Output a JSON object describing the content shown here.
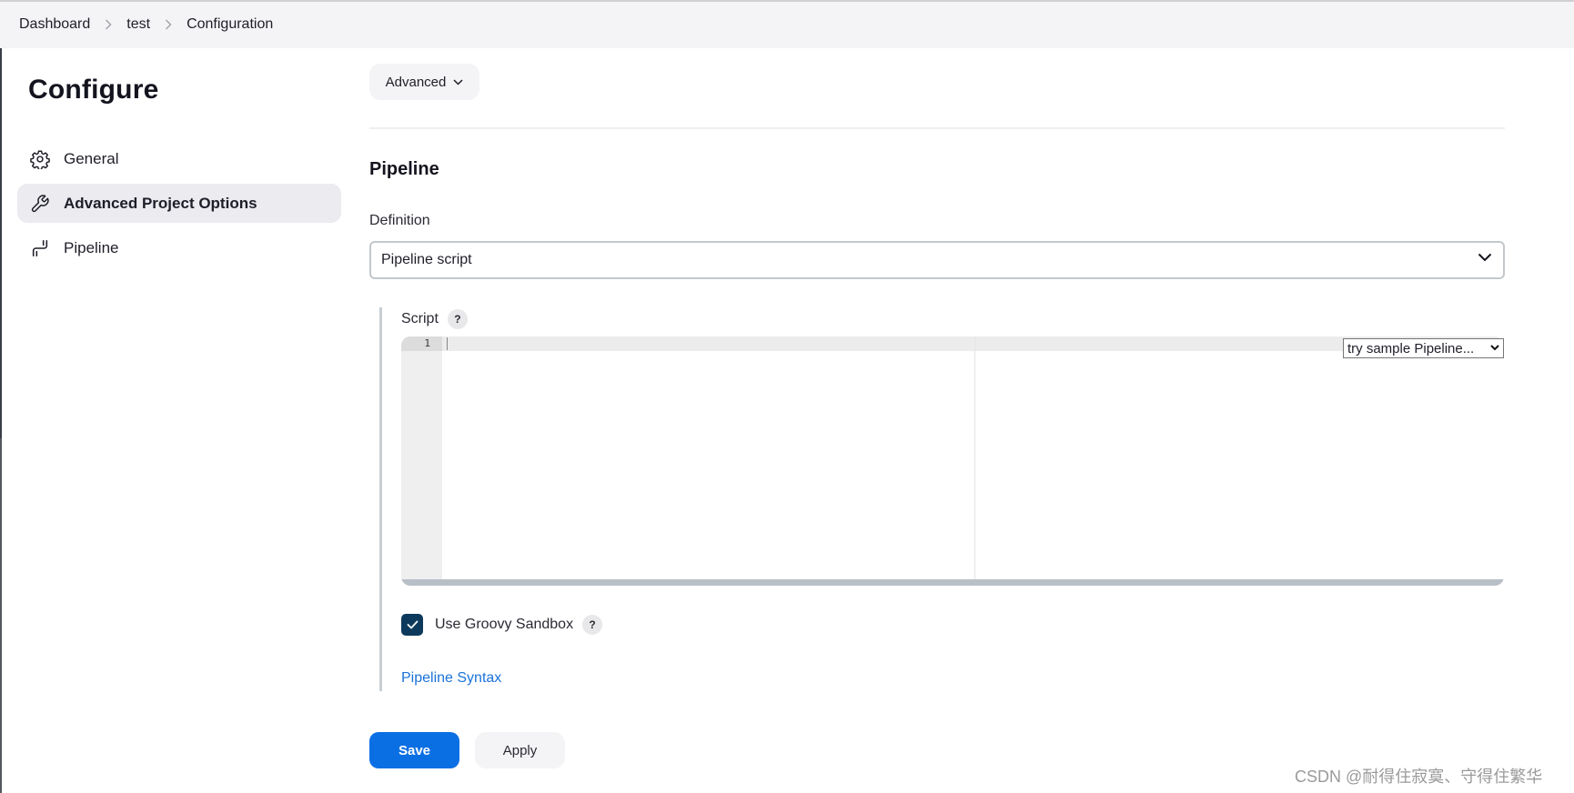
{
  "breadcrumb": {
    "items": [
      "Dashboard",
      "test",
      "Configuration"
    ]
  },
  "sidebar": {
    "title": "Configure",
    "items": [
      {
        "label": "General",
        "icon": "gear-icon",
        "active": false
      },
      {
        "label": "Advanced Project Options",
        "icon": "wrench-icon",
        "active": true
      },
      {
        "label": "Pipeline",
        "icon": "pipeline-icon",
        "active": false
      }
    ]
  },
  "main": {
    "advanced_button": "Advanced",
    "section_title": "Pipeline",
    "definition": {
      "label": "Definition",
      "selected": "Pipeline script"
    },
    "script": {
      "label": "Script",
      "help": "?",
      "line_numbers": [
        "1"
      ],
      "content": "",
      "sample_select": "try sample Pipeline..."
    },
    "sandbox": {
      "label": "Use Groovy Sandbox",
      "checked": true,
      "help": "?"
    },
    "syntax_link": "Pipeline Syntax"
  },
  "actions": {
    "save": "Save",
    "apply": "Apply"
  },
  "colors": {
    "primary": "#0b6fe4",
    "checkbox": "#0d3a5c",
    "link": "#1a73d9"
  },
  "watermark": "CSDN @耐得住寂寞、守得住繁华"
}
